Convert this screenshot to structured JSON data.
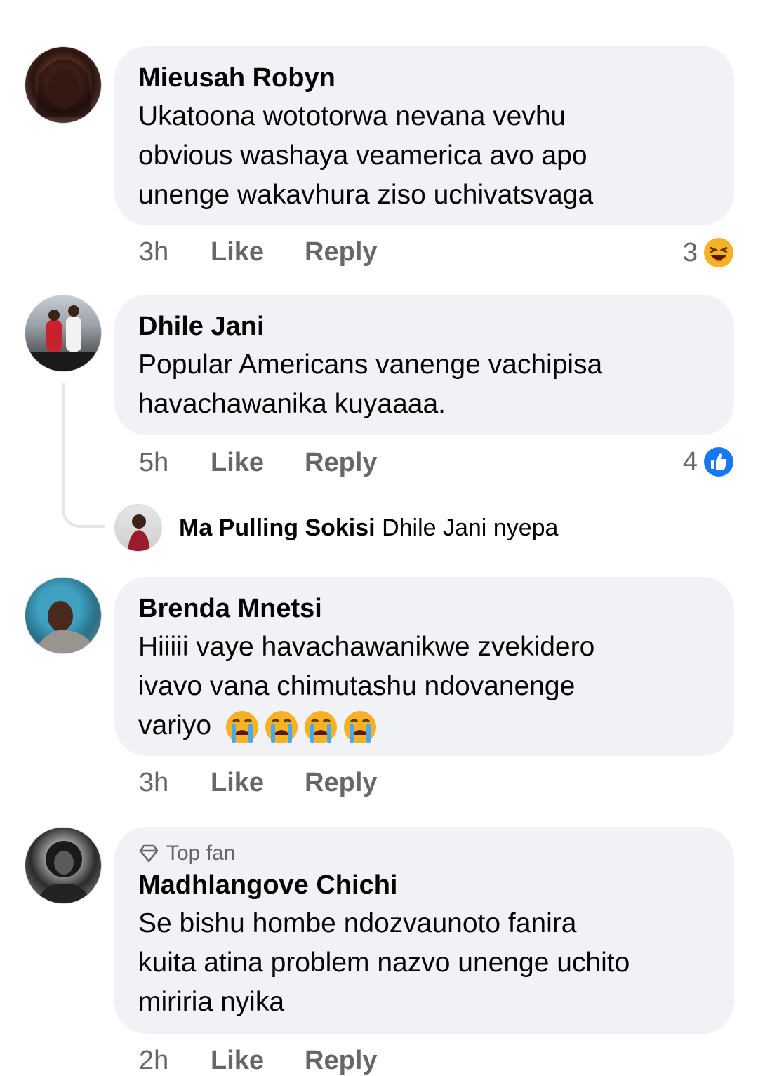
{
  "comments": [
    {
      "author": "Mieusah Robyn",
      "text_lines": [
        "Ukatoona wototorwa nevana vevhu",
        "obvious washaya veamerica avo apo",
        "unenge wakavhura ziso uchivatsvaga"
      ],
      "time": "3h",
      "like": "Like",
      "reply": "Reply",
      "reaction_count": "3",
      "reaction_icon": "laughing-emoji-icon"
    },
    {
      "author": "Dhile Jani",
      "text_lines": [
        "Popular Americans vanenge vachipisa",
        "havachawanika kuyaaaa."
      ],
      "time": "5h",
      "like": "Like",
      "reply": "Reply",
      "reaction_count": "4",
      "reaction_icon": "like-thumb-icon",
      "reply_preview": {
        "author": "Ma Pulling Sokisi",
        "text": "Dhile Jani nyepa"
      }
    },
    {
      "author": "Brenda Mnetsi",
      "text_lines": [
        "Hiiiii vaye havachawanikwe zvekidero",
        "ivavo vana chimutashu ndovanenge",
        "variyo"
      ],
      "emoji": "😭😭😭😭",
      "time": "3h",
      "like": "Like",
      "reply": "Reply"
    },
    {
      "badge": "Top fan",
      "author": "Madhlangove Chichi",
      "text_lines": [
        "Se bishu hombe ndozvaunoto fanira",
        "kuita atina problem nazvo unenge uchito",
        "miriria nyika"
      ],
      "time": "2h",
      "like": "Like",
      "reply": "Reply"
    }
  ],
  "colors": {
    "bubble": "#f0f2f5",
    "secondary_text": "#65676b",
    "like_blue": "#1877f2"
  }
}
